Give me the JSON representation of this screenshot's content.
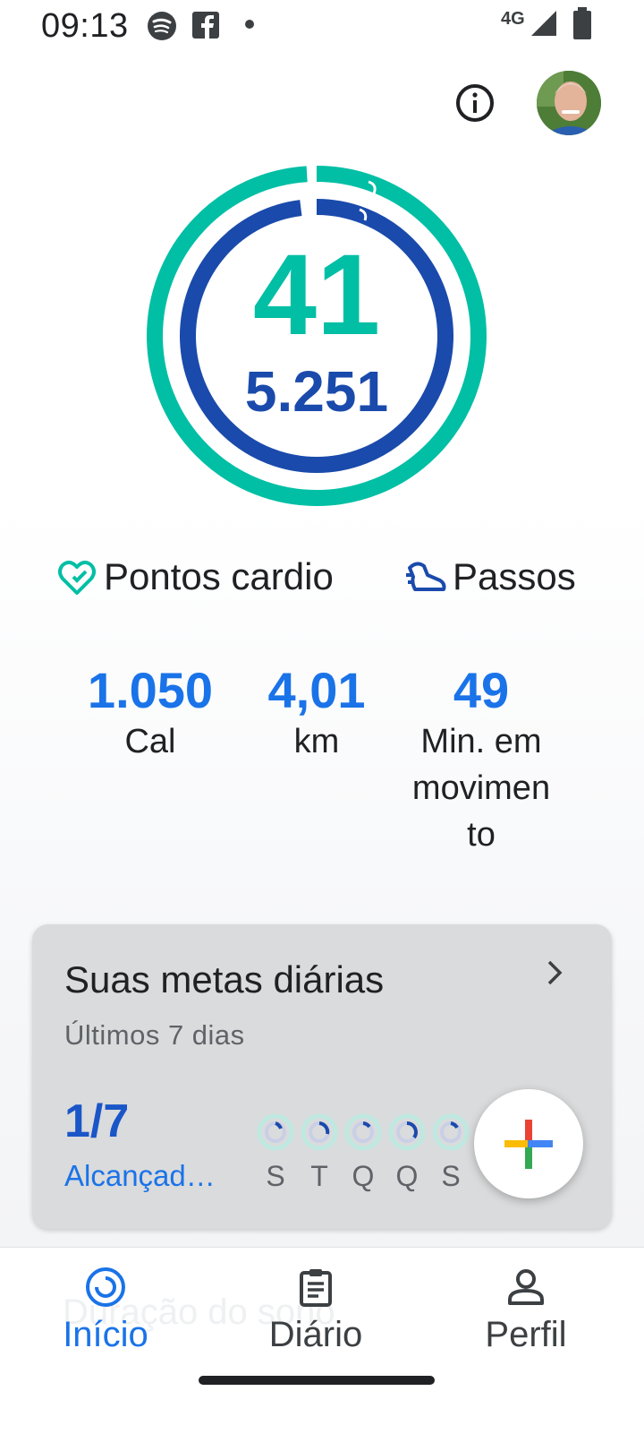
{
  "status_bar": {
    "time": "09:13",
    "network": "4G",
    "notification_icons": [
      "spotify-icon",
      "facebook-icon",
      "dot-icon"
    ]
  },
  "header": {
    "info_icon": "info-icon",
    "avatar": "profile-photo"
  },
  "rings": {
    "heart_points": "41",
    "steps": "5.251",
    "heart_points_progress": 0.99,
    "steps_progress": 0.98,
    "colors": {
      "heart": "#00bfa5",
      "steps": "#1a4aab"
    }
  },
  "metrics": {
    "heart_label": "Pontos cardio",
    "steps_label": "Passos"
  },
  "stats": [
    {
      "value": "1.050",
      "label": "Cal"
    },
    {
      "value": "4,01",
      "label": "km"
    },
    {
      "value": "49",
      "label_lines": [
        "Min. em",
        "movimen",
        "to"
      ]
    }
  ],
  "goals": {
    "title": "Suas metas diárias",
    "subtitle": "Últimos 7 dias",
    "count": "1/7",
    "achieved_label": "Alcançad…",
    "days": [
      "S",
      "T",
      "Q",
      "Q",
      "S"
    ]
  },
  "fab": {
    "icon": "plus-icon"
  },
  "nav": {
    "items": [
      {
        "label": "Início",
        "icon": "home-ring-icon",
        "active": true
      },
      {
        "label": "Diário",
        "icon": "journal-icon",
        "active": false
      },
      {
        "label": "Perfil",
        "icon": "person-icon",
        "active": false
      }
    ],
    "ghost": "Duração do sono"
  },
  "colors": {
    "accent_blue": "#1a73e8",
    "dark_blue": "#1a4aab",
    "green": "#00bfa5"
  }
}
